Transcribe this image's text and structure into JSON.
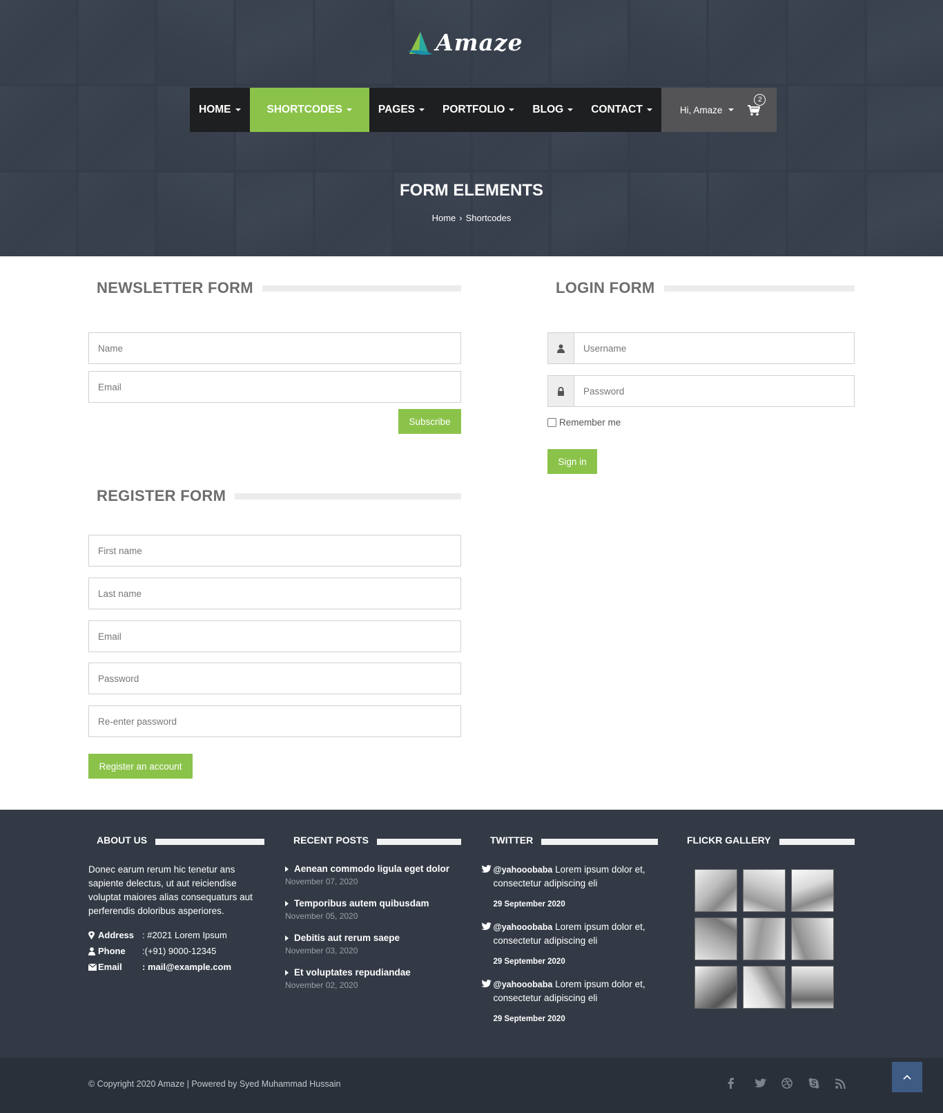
{
  "brand": {
    "name": "Amaze",
    "accent": "#8bc34a"
  },
  "nav": {
    "items": [
      {
        "label": "HOME",
        "active": false
      },
      {
        "label": "SHORTCODES",
        "active": true
      },
      {
        "label": "PAGES",
        "active": false
      },
      {
        "label": "PORTFOLIO",
        "active": false
      },
      {
        "label": "BLOG",
        "active": false
      },
      {
        "label": "CONTACT",
        "active": false
      }
    ],
    "user_greeting": "Hi, Amaze",
    "cart_count": "2"
  },
  "hero": {
    "title": "FORM ELEMENTS",
    "breadcrumb": [
      "Home",
      "Shortcodes"
    ]
  },
  "newsletter": {
    "title": "NEWSLETTER FORM",
    "name_placeholder": "Name",
    "email_placeholder": "Email",
    "submit_label": "Subscribe"
  },
  "login": {
    "title": "LOGIN FORM",
    "username_placeholder": "Username",
    "password_placeholder": "Password",
    "remember_label": "Remember me",
    "submit_label": "Sign in"
  },
  "register": {
    "title": "REGISTER FORM",
    "fields": [
      "First name",
      "Last name",
      "Email",
      "Password",
      "Re-enter password"
    ],
    "submit_label": "Register an account"
  },
  "footer": {
    "about": {
      "title": "ABOUT US",
      "text": "Donec earum rerum hic tenetur ans sapiente delectus, ut aut reiciendise voluptat maiores alias consequaturs aut perferendis doloribus asperiores.",
      "contacts": [
        {
          "label": "Address",
          "value": ": #2021 Lorem Ipsum",
          "icon": "map-marker-icon"
        },
        {
          "label": "Phone",
          "value": ":(+91) 9000-12345",
          "icon": "phone-user-icon"
        },
        {
          "label": "Email",
          "value": ": mail@example.com",
          "icon": "envelope-icon"
        }
      ]
    },
    "recent_posts": {
      "title": "RECENT POSTS",
      "items": [
        {
          "title": "Aenean commodo ligula eget dolor",
          "date": "November 07, 2020"
        },
        {
          "title": "Temporibus autem quibusdam",
          "date": "November 05, 2020"
        },
        {
          "title": "Debitis aut rerum saepe",
          "date": "November 03, 2020"
        },
        {
          "title": "Et voluptates repudiandae",
          "date": "November 02, 2020"
        }
      ]
    },
    "twitter": {
      "title": "TWITTER",
      "items": [
        {
          "handle": "@yahooobaba",
          "text": " Lorem ipsum dolor et, consectetur adipiscing eli",
          "date": "29 September 2020"
        },
        {
          "handle": "@yahooobaba",
          "text": " Lorem ipsum dolor et, consectetur adipiscing eli",
          "date": "29 September 2020"
        },
        {
          "handle": "@yahooobaba",
          "text": " Lorem ipsum dolor et, consectetur adipiscing eli",
          "date": "29 September 2020"
        }
      ]
    },
    "flickr": {
      "title": "FLICKR GALLERY"
    },
    "copyright": "© Copyright 2020 Amaze | Powered by Syed Muhammad Hussain",
    "social_icons": [
      "facebook-icon",
      "twitter-icon",
      "dribbble-icon",
      "skype-icon",
      "rss-icon"
    ]
  }
}
